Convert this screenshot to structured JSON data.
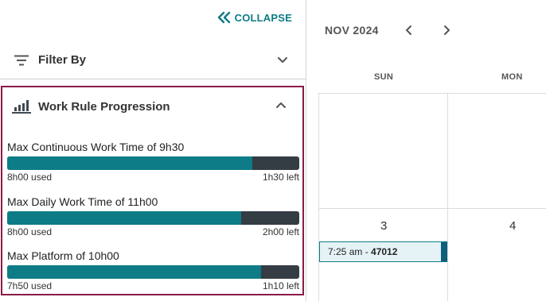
{
  "left_panel": {
    "collapse_label": "COLLAPSE",
    "filter_label": "Filter By",
    "work_rules": {
      "title": "Work Rule Progression",
      "rules": [
        {
          "name": "Max Continuous Work Time of 9h30",
          "used": "8h00 used",
          "left": "1h30 left",
          "progress": 0.84
        },
        {
          "name": "Max Daily Work Time of 11h00",
          "used": "8h00 used",
          "left": "2h00 left",
          "progress": 0.8
        },
        {
          "name": "Max Platform of 10h00",
          "used": "7h50 used",
          "left": "1h10 left",
          "progress": 0.87
        }
      ]
    }
  },
  "calendar": {
    "month_label": "NOV 2024",
    "weekdays": [
      "SUN",
      "MON"
    ],
    "days": [
      "3",
      "4"
    ],
    "event": {
      "time": "7:25 am - ",
      "id": "47012"
    }
  },
  "colors": {
    "accent": "#0e7c86",
    "bar_remaining": "#343c44",
    "highlight_border": "#8b1a47",
    "event_bg": "#e6f3f6",
    "event_edge": "#0d5f7a"
  }
}
